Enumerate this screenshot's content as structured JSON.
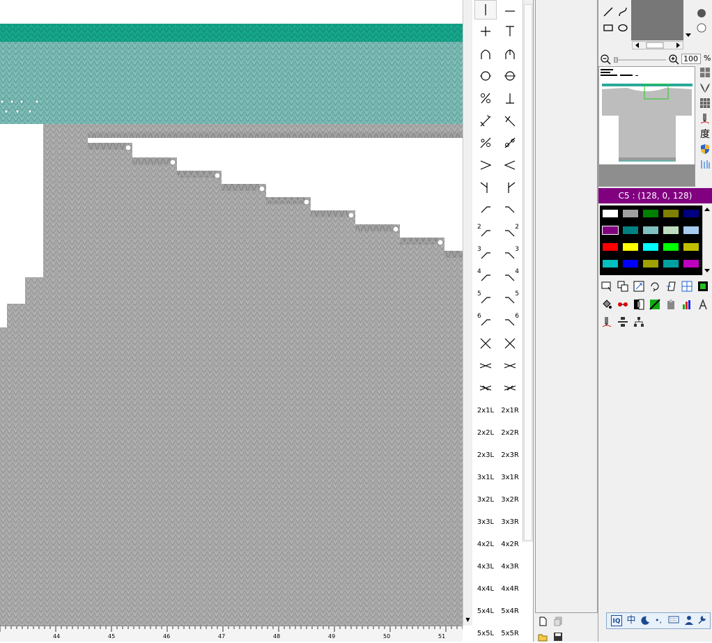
{
  "ruler": {
    "ticks": [
      "44",
      "45",
      "46",
      "47",
      "48",
      "49",
      "50",
      "51"
    ]
  },
  "stitch_tools": {
    "text_items": [
      [
        "2x1L",
        "2x1R"
      ],
      [
        "2x2L",
        "2x2R"
      ],
      [
        "2x3L",
        "2x3R"
      ],
      [
        "3x1L",
        "3x1R"
      ],
      [
        "3x2L",
        "3x2R"
      ],
      [
        "3x3L",
        "3x3R"
      ],
      [
        "4x2L",
        "4x2R"
      ],
      [
        "4x3L",
        "4x3R"
      ],
      [
        "4x4L",
        "4x4R"
      ],
      [
        "5x4L",
        "5x4R"
      ],
      [
        "5x5L",
        "5x5R"
      ]
    ],
    "numbered": [
      "2",
      "3",
      "4",
      "5",
      "6"
    ]
  },
  "zoom": {
    "value": "100",
    "unit": "%"
  },
  "color_info": {
    "label": "C5 : (128, 0, 128)"
  },
  "palette": {
    "rows": [
      [
        "#ffffff",
        "#a0a0a0",
        "#008000",
        "#808000",
        "#000080"
      ],
      [
        "#800080",
        "#008080",
        "#80c0c0",
        "#c0dcc0",
        "#a6caf0"
      ],
      [
        "#ff0000",
        "#ffff00",
        "#00ffff",
        "#00ff00",
        "#c0c000"
      ],
      [
        "#00c0c0",
        "#0000ff",
        "#a0a000",
        "#00a0a0",
        "#c000c0"
      ]
    ]
  },
  "side_icons": {
    "char_label": "度"
  },
  "tray": {
    "ime": "中",
    "punct": "•,"
  },
  "colors": {
    "teal_top": "#1aa88e",
    "teal_body": "#79b8b2",
    "knit_gray": "#a9a9a9",
    "accent_purple": "#800080"
  }
}
